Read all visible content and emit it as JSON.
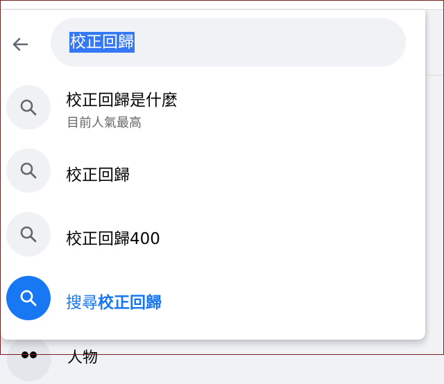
{
  "search": {
    "query": "校正回歸"
  },
  "suggestions": [
    {
      "label": "校正回歸是什麼",
      "subtitle": "目前人氣最高",
      "icon": "search-icon"
    },
    {
      "label": "校正回歸",
      "icon": "search-icon"
    },
    {
      "label": "校正回歸400",
      "icon": "search-icon"
    }
  ],
  "search_action": {
    "prefix": "搜尋",
    "query": "校正回歸",
    "icon": "search-icon"
  },
  "background_item": {
    "label": "人物",
    "icon": "people-icon"
  },
  "colors": {
    "accent": "#1877f2",
    "selection": "#3478f6",
    "icon_bg": "#eff1f4",
    "secondary_text": "#65676b"
  }
}
